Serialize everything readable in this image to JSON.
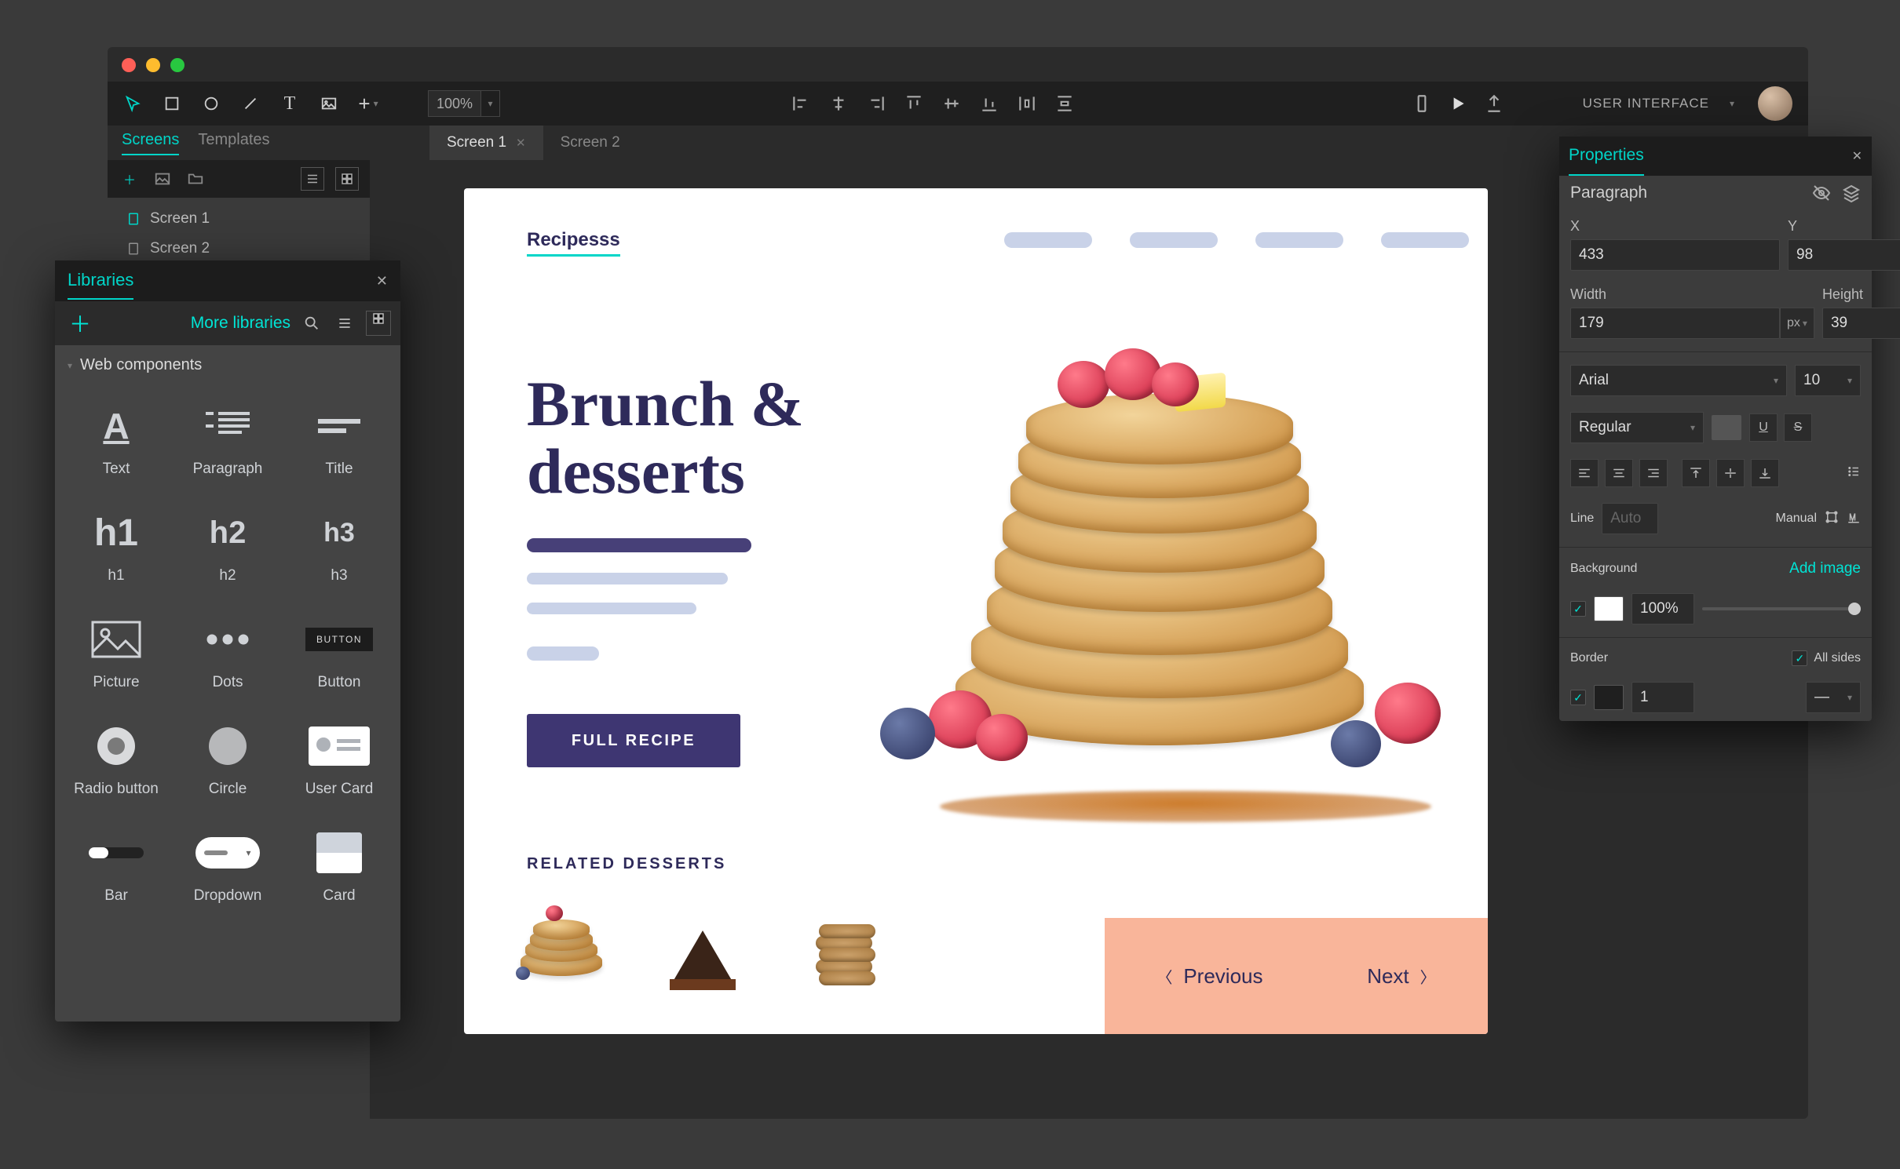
{
  "project_label": "USER INTERFACE",
  "zoom": "100%",
  "side_panel_tabs": {
    "active": "Screens",
    "inactive": "Templates"
  },
  "open_docs": [
    {
      "name": "Screen 1",
      "active": true
    },
    {
      "name": "Screen 2",
      "active": false
    }
  ],
  "screens": [
    "Screen 1",
    "Screen 2"
  ],
  "libraries": {
    "panel_title": "Libraries",
    "more": "More libraries",
    "section": "Web components",
    "items": [
      "Text",
      "Paragraph",
      "Title",
      "h1",
      "h2",
      "h3",
      "Picture",
      "Dots",
      "Button",
      "Radio button",
      "Circle",
      "User Card",
      "Bar",
      "Dropdown",
      "Card"
    ],
    "button_chip": "BUTTON"
  },
  "canvas": {
    "logo": "Recipesss",
    "headline": "Brunch &\ndesserts",
    "cta": "FULL RECIPE",
    "related": "RELATED DESSERTS",
    "prev": "Previous",
    "next": "Next"
  },
  "properties": {
    "panel_title": "Properties",
    "selection": "Paragraph",
    "x_label": "X",
    "x": "433",
    "y_label": "Y",
    "y": "98",
    "w_label": "Width",
    "w": "179",
    "h_label": "Height",
    "h": "39",
    "unit": "px",
    "font": "Arial",
    "font_size": "10",
    "weight": "Regular",
    "line_label": "Line",
    "line_value": "Auto",
    "manual_label": "Manual",
    "bg_label": "Background",
    "add_image": "Add image",
    "bg_opacity": "100%",
    "border_label": "Border",
    "all_sides": "All sides",
    "border_width": "1",
    "bg_color": "#FFFFFF",
    "border_color": "#1f1f1f"
  }
}
